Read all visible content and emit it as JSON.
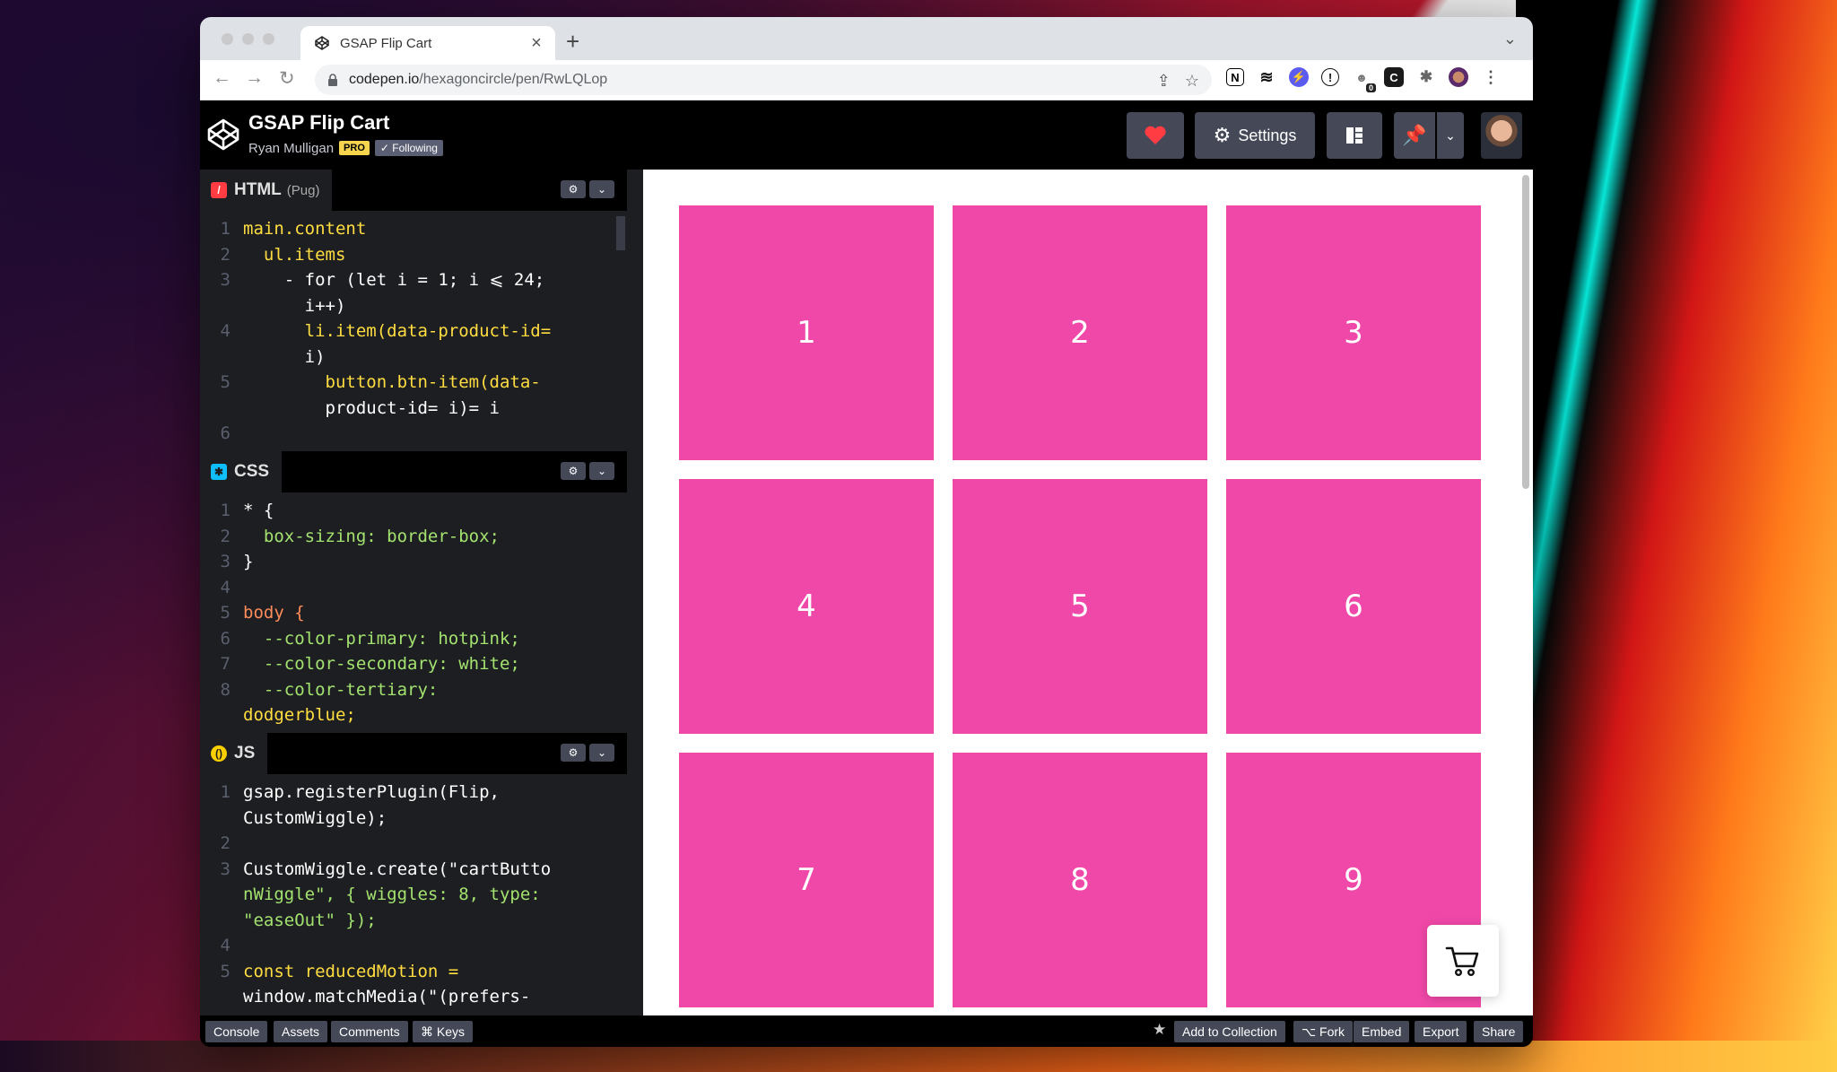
{
  "browser": {
    "tab_title": "GSAP Flip Cart",
    "new_tab": "+",
    "close": "×",
    "url_host": "codepen.io",
    "url_path": "/hexagoncircle/pen/RwLQLop",
    "ext_badge": "0"
  },
  "header": {
    "pen_title": "GSAP Flip Cart",
    "author": "Ryan Mulligan",
    "pro_badge": "PRO",
    "following": "✓ Following",
    "settings_label": "Settings"
  },
  "editors": {
    "html": {
      "label": "HTML",
      "sub": "(Pug)"
    },
    "css": {
      "label": "CSS"
    },
    "js": {
      "label": "JS"
    }
  },
  "html_code": [
    {
      "n": "1",
      "t": "main.content"
    },
    {
      "n": "2",
      "t": "  ul.items"
    },
    {
      "n": "3",
      "t": "    - for (let i = 1; i ⩽ 24;"
    },
    {
      "n": "",
      "t": "      i++)"
    },
    {
      "n": "4",
      "t": "      li.item(data-product-id="
    },
    {
      "n": "",
      "t": "      i)"
    },
    {
      "n": "5",
      "t": "        button.btn-item(data-"
    },
    {
      "n": "",
      "t": "        product-id= i)= i"
    },
    {
      "n": "6",
      "t": ""
    }
  ],
  "css_code": [
    {
      "n": "1",
      "t": "* {"
    },
    {
      "n": "2",
      "t": "  box-sizing: border-box;"
    },
    {
      "n": "3",
      "t": "}"
    },
    {
      "n": "4",
      "t": ""
    },
    {
      "n": "5",
      "t": "body {"
    },
    {
      "n": "6",
      "t": "  --color-primary: hotpink;"
    },
    {
      "n": "7",
      "t": "  --color-secondary: white;"
    },
    {
      "n": "8",
      "t": "  --color-tertiary:"
    },
    {
      "n": "",
      "t": "dodgerblue;"
    }
  ],
  "js_code": [
    {
      "n": "1",
      "t": "gsap.registerPlugin(Flip,"
    },
    {
      "n": "",
      "t": "CustomWiggle);"
    },
    {
      "n": "2",
      "t": ""
    },
    {
      "n": "3",
      "t": "CustomWiggle.create(\"cartButto"
    },
    {
      "n": "",
      "t": "nWiggle\", { wiggles: 8, type:"
    },
    {
      "n": "",
      "t": "\"easeOut\" });"
    },
    {
      "n": "4",
      "t": ""
    },
    {
      "n": "5",
      "t": "const reducedMotion ="
    },
    {
      "n": "",
      "t": "window.matchMedia(\"(prefers-"
    }
  ],
  "preview": {
    "items": [
      "1",
      "2",
      "3",
      "4",
      "5",
      "6",
      "7",
      "8",
      "9"
    ],
    "item_color": "#f048a8"
  },
  "footer": {
    "left": [
      "Console",
      "Assets",
      "Comments",
      "⌘ Keys"
    ],
    "right": [
      "Add to Collection",
      "⌥ Fork",
      "Embed",
      "Export",
      "Share"
    ]
  },
  "colors": {
    "codepen_button": "#444857",
    "heart": "#ff3c41",
    "pro": "#f7d54f"
  }
}
